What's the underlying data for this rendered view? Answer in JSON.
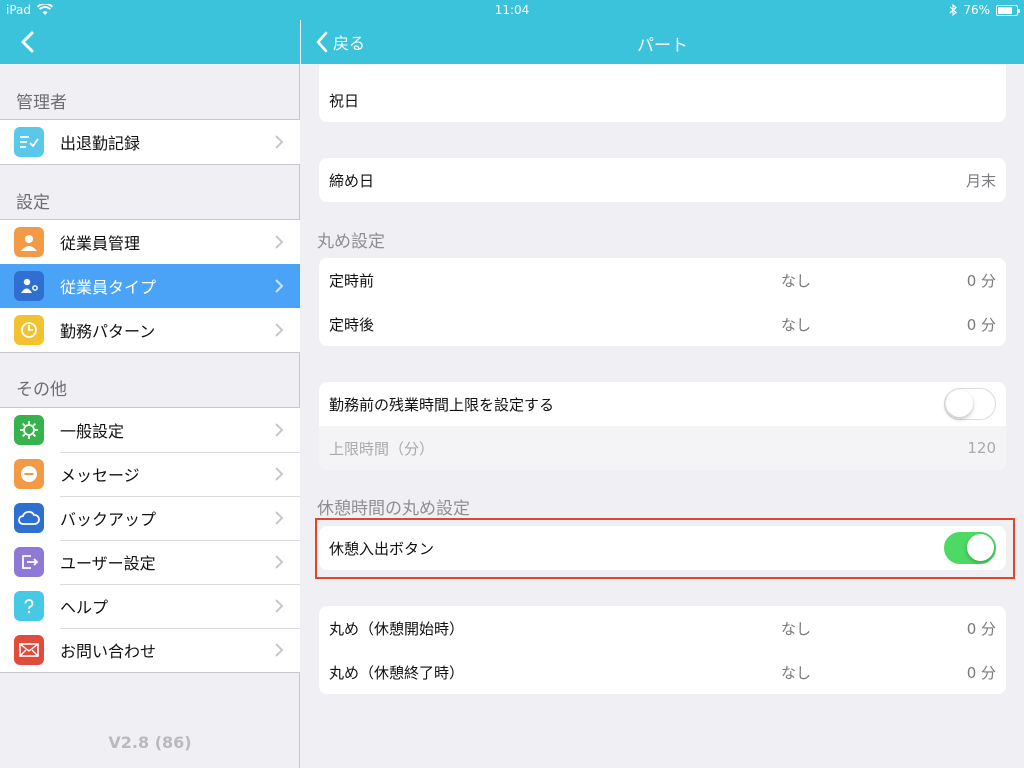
{
  "status_bar": {
    "device": "iPad",
    "time": "11:04",
    "battery_text": "76%",
    "battery_level": 0.76
  },
  "sidebar": {
    "sections": [
      {
        "title": "管理者",
        "items": [
          {
            "label": "出退勤記録",
            "icon": "checklist-icon",
            "color": "#5ac8e8"
          }
        ]
      },
      {
        "title": "設定",
        "items": [
          {
            "label": "従業員管理",
            "icon": "person-icon",
            "color": "#f29a45"
          },
          {
            "label": "従業員タイプ",
            "icon": "person-tag-icon",
            "color": "#2f6fd0"
          },
          {
            "label": "勤務パターン",
            "icon": "clock-icon",
            "color": "#f2c230"
          }
        ]
      },
      {
        "title": "その他",
        "items": [
          {
            "label": "一般設定",
            "icon": "gear-icon",
            "color": "#37b24d"
          },
          {
            "label": "メッセージ",
            "icon": "message-icon",
            "color": "#f29a45"
          },
          {
            "label": "バックアップ",
            "icon": "cloud-icon",
            "color": "#2f6fd0"
          },
          {
            "label": "ユーザー設定",
            "icon": "logout-icon",
            "color": "#8e7ad6"
          },
          {
            "label": "ヘルプ",
            "icon": "question-icon",
            "color": "#45c9e4"
          },
          {
            "label": "お問い合わせ",
            "icon": "mail-icon",
            "color": "#e04b3c"
          }
        ]
      }
    ],
    "selected": "従業員タイプ",
    "version": "V2.8 (86)"
  },
  "detail": {
    "back_label": "戻る",
    "title": "パート",
    "holiday_label": "祝日",
    "closing_day": {
      "label": "締め日",
      "value": "月末"
    },
    "rounding_section": "丸め設定",
    "rounding_rows": [
      {
        "label": "定時前",
        "mode": "なし",
        "value": "0 分"
      },
      {
        "label": "定時後",
        "mode": "なし",
        "value": "0 分"
      }
    ],
    "overtime_toggle_label": "勤務前の残業時間上限を設定する",
    "overtime_toggle_on": false,
    "limit_label": "上限時間（分）",
    "limit_value": "120",
    "break_section": "休憩時間の丸め設定",
    "break_toggle_label": "休憩入出ボタン",
    "break_toggle_on": true,
    "break_rows": [
      {
        "label": "丸め（休憩開始時）",
        "mode": "なし",
        "value": "0 分"
      },
      {
        "label": "丸め（休憩終了時）",
        "mode": "なし",
        "value": "0 分"
      }
    ]
  }
}
